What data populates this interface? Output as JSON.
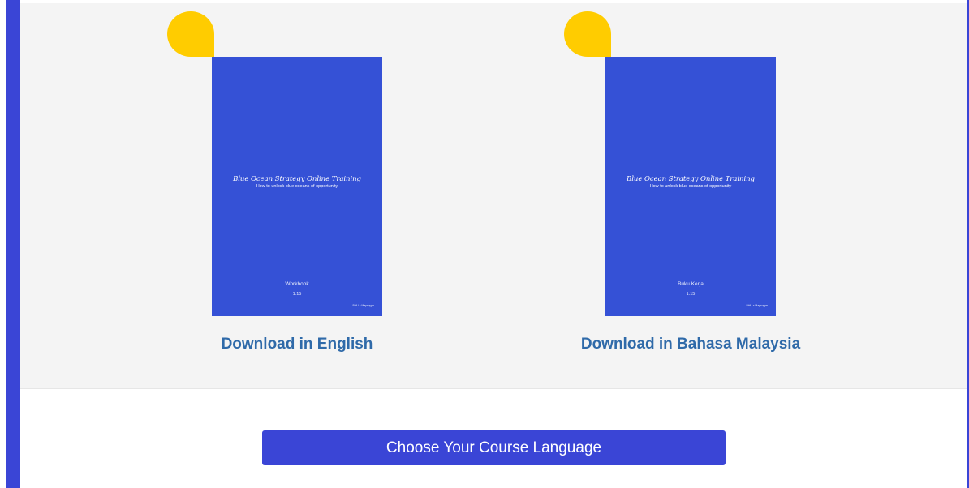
{
  "books": [
    {
      "cover_title": "Blue Ocean Strategy Online Training",
      "cover_subtitle": "How to unlock blue oceans of opportunity",
      "cover_kind": "Workbook",
      "cover_version": "1.15",
      "cover_mark": "ВНЧ х Маргоуре",
      "link_label": "Download in English"
    },
    {
      "cover_title": "Blue Ocean Strategy Online Training",
      "cover_subtitle": "How to unlock blue oceans of opportunity",
      "cover_kind": "Buku Kerja",
      "cover_version": "1.15",
      "cover_mark": "ВНЧ х Маргоуре",
      "link_label": "Download in Bahasa Malaysia"
    }
  ],
  "cta": {
    "label": "Choose Your Course Language"
  },
  "colors": {
    "accent": "#3a45d6",
    "cover": "#3551d6",
    "link": "#2f6aa9",
    "bubble": "#ffcc00",
    "panel": "#f4f4f4"
  }
}
